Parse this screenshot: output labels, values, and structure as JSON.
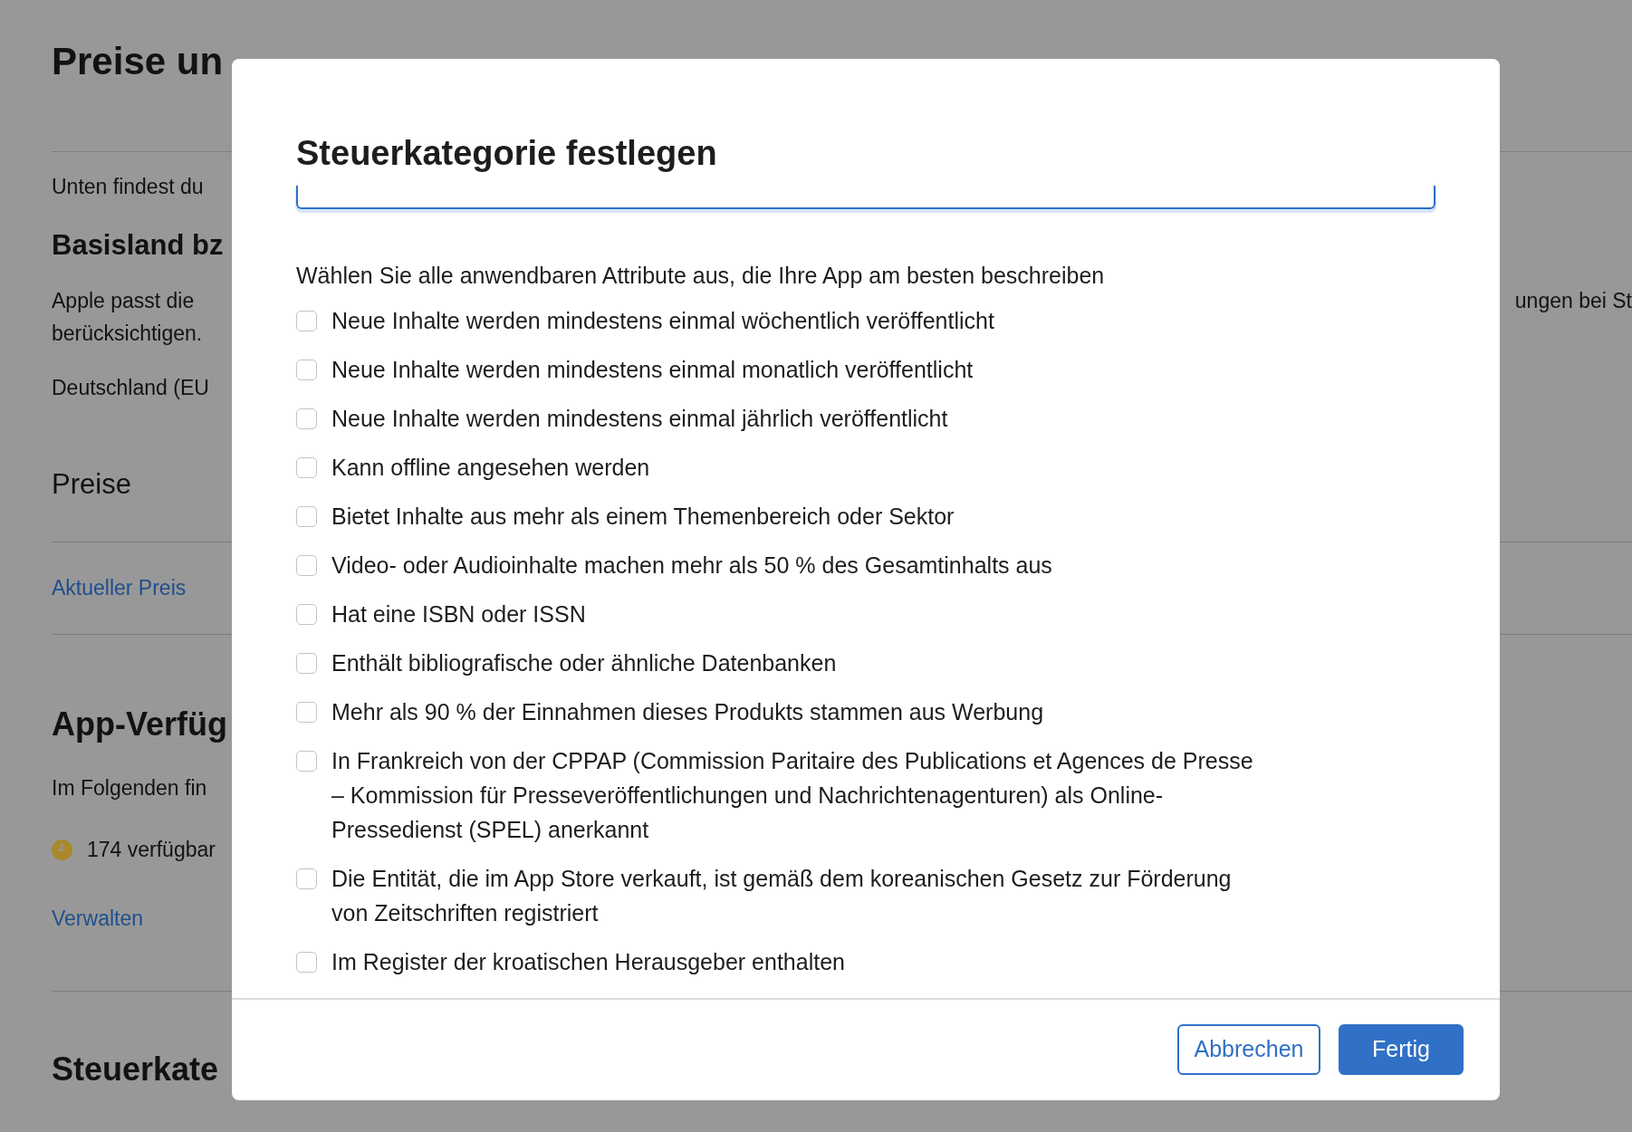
{
  "background": {
    "page_title": "Preise un",
    "intro": "Unten findest du",
    "base_country_heading": "Basisland bz",
    "base_country_text": [
      "Apple passt die",
      "berücksichtigen."
    ],
    "right_fragment": "ungen bei St",
    "base_country_value": "Deutschland (EU",
    "prices_heading": "Preise",
    "current_price_link": "Aktueller Preis",
    "availability_heading": "App-Verfüg",
    "availability_text": "Im Folgenden fin",
    "availability_status": "174 verfügbar",
    "manage_link": "Verwalten",
    "tax_heading": "Steuerkate"
  },
  "dialog": {
    "title": "Steuerkategorie festlegen",
    "prompt": "Wählen Sie alle anwendbaren Attribute aus, die Ihre App am besten beschreiben",
    "options": [
      {
        "label": "Neue Inhalte werden mindestens einmal wöchentlich veröffentlicht",
        "checked": false
      },
      {
        "label": "Neue Inhalte werden mindestens einmal monatlich veröffentlicht",
        "checked": false
      },
      {
        "label": "Neue Inhalte werden mindestens einmal jährlich veröffentlicht",
        "checked": false
      },
      {
        "label": "Kann offline angesehen werden",
        "checked": false
      },
      {
        "label": "Bietet Inhalte aus mehr als einem Themenbereich oder Sektor",
        "checked": false
      },
      {
        "label": "Video- oder Audioinhalte machen mehr als 50 % des Gesamtinhalts aus",
        "checked": false
      },
      {
        "label": "Hat eine ISBN oder ISSN",
        "checked": false
      },
      {
        "label": "Enthält bibliografische oder ähnliche Datenbanken",
        "checked": false
      },
      {
        "label": "Mehr als 90 % der Einnahmen dieses Produkts stammen aus Werbung",
        "checked": false
      },
      {
        "label": "In Frankreich von der CPPAP (Commission Paritaire des Publications et Agences de Presse – Kommission für Presseveröffentlichungen und Nachrichtenagenturen) als Online-Pressedienst (SPEL) anerkannt",
        "checked": false
      },
      {
        "label": "Die Entität, die im App Store verkauft, ist gemäß dem koreanischen Gesetz zur Förderung von Zeitschriften registriert",
        "checked": false
      },
      {
        "label": "Im Register der kroatischen Herausgeber enthalten",
        "checked": false
      }
    ],
    "buttons": [
      {
        "label": "Abbrechen",
        "kind": "secondary"
      },
      {
        "label": "Fertig",
        "kind": "primary"
      }
    ]
  }
}
